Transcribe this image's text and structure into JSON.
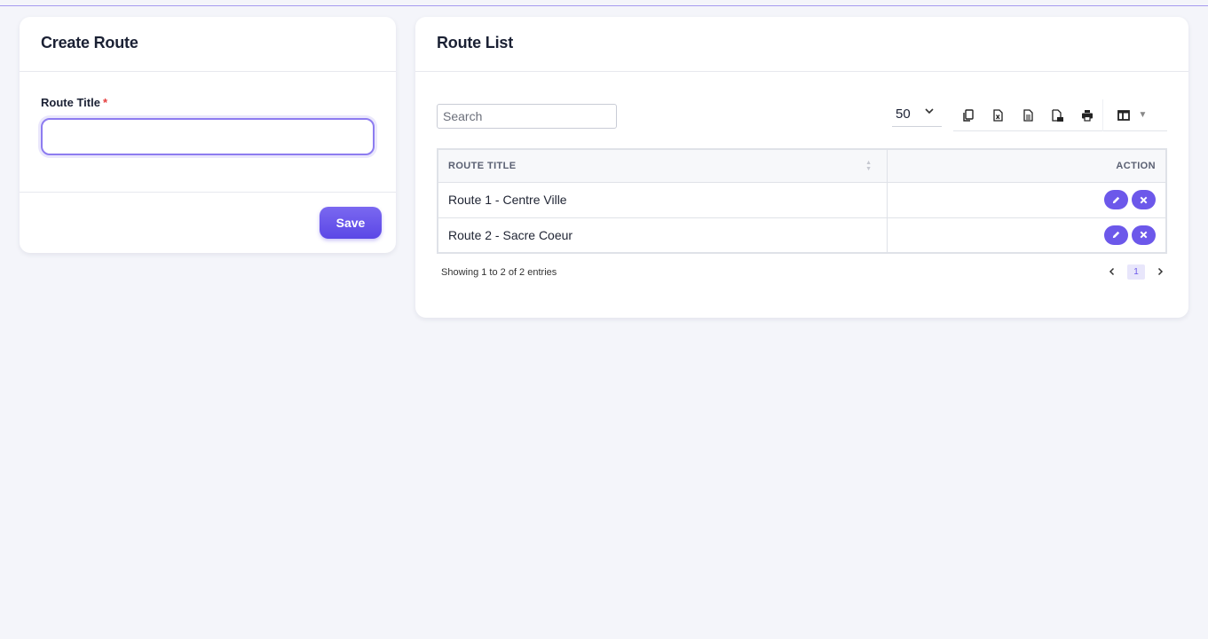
{
  "create_card": {
    "title": "Create Route",
    "field_label": "Route Title",
    "required_mark": "*",
    "input_value": "",
    "save_label": "Save"
  },
  "list_card": {
    "title": "Route List",
    "search_placeholder": "Search",
    "page_size": "50",
    "toolbar_icons": [
      "copy-icon",
      "excel-icon",
      "csv-icon",
      "pdf-icon",
      "print-icon",
      "columns-icon"
    ],
    "columns": [
      "ROUTE TITLE",
      "ACTION"
    ],
    "rows": [
      {
        "title": "Route 1 - Centre Ville"
      },
      {
        "title": "Route 2 - Sacre Coeur"
      }
    ],
    "info": "Showing 1 to 2 of 2 entries",
    "current_page": "1"
  },
  "colors": {
    "accent": "#6c58ea",
    "background": "#f4f5fa",
    "required": "#e53e3e"
  }
}
